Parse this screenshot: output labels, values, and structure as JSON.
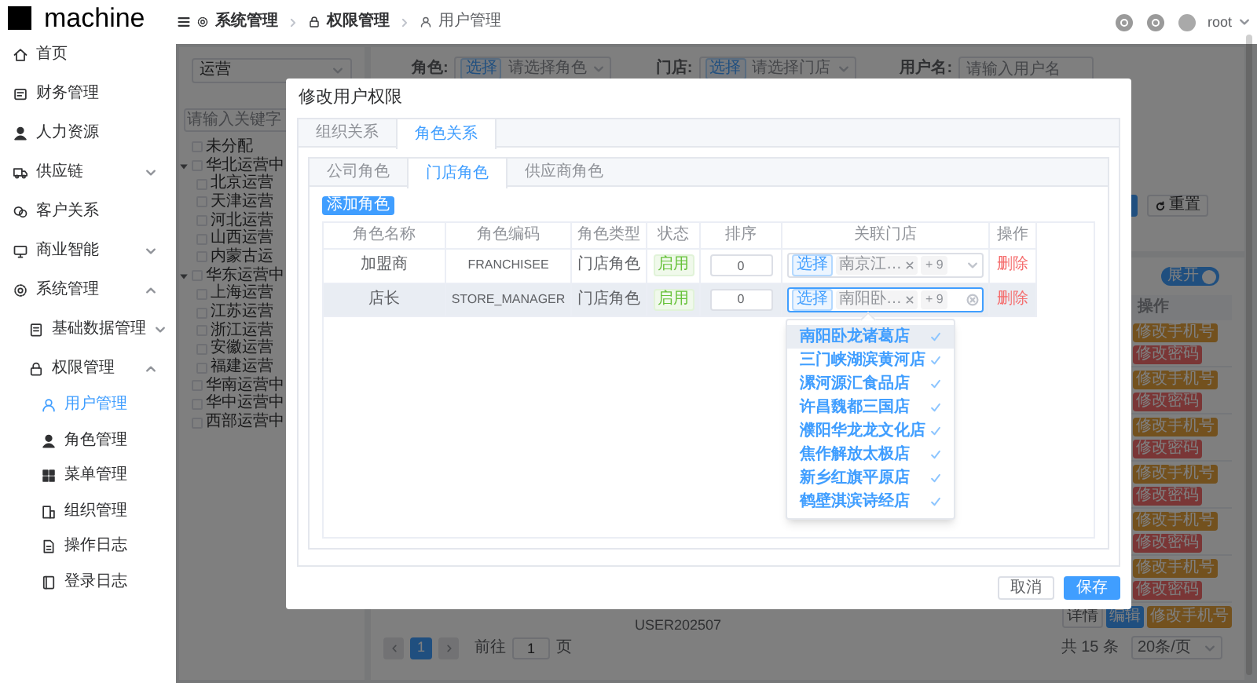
{
  "header": {
    "logo": "machine",
    "breadcrumb": [
      "系统管理",
      "权限管理",
      "用户管理"
    ],
    "user": "root"
  },
  "sidebar": {
    "items": [
      {
        "label": "首页",
        "selected": false
      },
      {
        "label": "财务管理",
        "selected": false
      },
      {
        "label": "人力资源",
        "selected": false
      },
      {
        "label": "供应链",
        "selected": false,
        "expanded": false
      },
      {
        "label": "客户关系",
        "selected": false
      },
      {
        "label": "商业智能",
        "selected": false,
        "expanded": false
      },
      {
        "label": "系统管理",
        "selected": false,
        "expanded": true,
        "children": [
          {
            "label": "基础数据管理",
            "selected": false,
            "expanded": false
          },
          {
            "label": "权限管理",
            "selected": false,
            "expanded": true,
            "children": [
              {
                "label": "用户管理",
                "selected": true
              },
              {
                "label": "角色管理",
                "selected": false
              },
              {
                "label": "菜单管理",
                "selected": false
              },
              {
                "label": "组织管理",
                "selected": false
              },
              {
                "label": "操作日志",
                "selected": false
              },
              {
                "label": "登录日志",
                "selected": false
              }
            ]
          }
        ]
      }
    ]
  },
  "org_panel": {
    "select": "运营",
    "search_placeholder": "请输入关键字",
    "tree": [
      {
        "label": "未分配",
        "checked": false
      },
      {
        "label": "华北运营中",
        "checked": false,
        "expanded": true,
        "children": [
          {
            "label": "北京运营",
            "checked": false
          },
          {
            "label": "天津运营",
            "checked": false
          },
          {
            "label": "河北运营",
            "checked": false
          },
          {
            "label": "山西运营",
            "checked": false
          },
          {
            "label": "内蒙古运",
            "checked": false
          }
        ]
      },
      {
        "label": "华东运营中",
        "checked": false,
        "expanded": true,
        "children": [
          {
            "label": "上海运营",
            "checked": false
          },
          {
            "label": "江苏运营",
            "checked": false
          },
          {
            "label": "浙江运营",
            "checked": false
          },
          {
            "label": "安徽运营",
            "checked": false
          },
          {
            "label": "福建运营",
            "checked": false
          }
        ]
      },
      {
        "label": "华南运营中",
        "checked": false
      },
      {
        "label": "华中运营中",
        "checked": false
      },
      {
        "label": "西部运营中",
        "checked": false
      }
    ]
  },
  "filters": [
    {
      "kind": "select",
      "label": "角色:",
      "tag": "选择",
      "placeholder": "请选择角色"
    },
    {
      "kind": "select",
      "label": "门店:",
      "tag": "选择",
      "placeholder": "请选择门店"
    },
    {
      "kind": "input",
      "label": "用户名:",
      "placeholder": "请输入用户名"
    }
  ],
  "reset_button": "重置",
  "toggle": {
    "label": "展开",
    "on": true
  },
  "user_table": {
    "action_header": "操作",
    "rows": [
      {
        "actions": [
          {
            "kind": "phone",
            "label": "修改手机号"
          },
          {
            "kind": "password",
            "label": "修改密码"
          }
        ]
      },
      {
        "actions": [
          {
            "kind": "phone",
            "label": "修改手机号"
          },
          {
            "kind": "password",
            "label": "修改密码"
          }
        ]
      },
      {
        "actions": [
          {
            "kind": "phone",
            "label": "修改手机号"
          },
          {
            "kind": "password",
            "label": "修改密码"
          }
        ]
      },
      {
        "actions": [
          {
            "kind": "phone",
            "label": "修改手机号"
          },
          {
            "kind": "password",
            "label": "修改密码"
          }
        ]
      },
      {
        "actions": [
          {
            "kind": "phone",
            "label": "修改手机号"
          },
          {
            "kind": "password",
            "label": "修改密码"
          }
        ]
      },
      {
        "actions": [
          {
            "kind": "phone",
            "label": "修改手机号"
          },
          {
            "kind": "password",
            "label": "修改密码"
          }
        ]
      },
      {
        "user": "USER202507",
        "actions": [
          {
            "kind": "detail",
            "label": "详情"
          },
          {
            "kind": "edit",
            "label": "编辑"
          },
          {
            "kind": "phone",
            "label": "修改手机号"
          }
        ]
      }
    ]
  },
  "pagination": {
    "pages": [
      {
        "label": "1",
        "selected": true
      }
    ],
    "goto_label": "前往",
    "goto_value": "1",
    "page_unit": "页",
    "total": "共 15 条",
    "page_size": "20条/页"
  },
  "dialog": {
    "title": "修改用户权限",
    "tabs": [
      {
        "label": "组织关系",
        "selected": false
      },
      {
        "label": "角色关系",
        "selected": true
      }
    ],
    "subtabs": [
      {
        "label": "公司角色",
        "selected": false
      },
      {
        "label": "门店角色",
        "selected": true
      },
      {
        "label": "供应商角色",
        "selected": false
      }
    ],
    "add_button": "添加角色",
    "table": {
      "columns": [
        "角色名称",
        "角色编码",
        "角色类型",
        "状态",
        "排序",
        "关联门店",
        "操作"
      ],
      "rows": [
        {
          "name": "加盟商",
          "code": "FRANCHISEE",
          "type": "门店角色",
          "status": {
            "label": "启用",
            "kind": "success"
          },
          "sort": "0",
          "stores": {
            "button": "选择",
            "tags": [
              "南京江…"
            ],
            "more": "+ 9",
            "focused": false
          },
          "action": "删除",
          "hovered": false
        },
        {
          "name": "店长",
          "code": "STORE_MANAGER",
          "type": "门店角色",
          "status": {
            "label": "启用",
            "kind": "success"
          },
          "sort": "0",
          "stores": {
            "button": "选择",
            "tags": [
              "南阳卧…"
            ],
            "more": "+ 9",
            "focused": true
          },
          "action": "删除",
          "hovered": true
        }
      ]
    },
    "dropdown": {
      "items": [
        {
          "label": "南阳卧龙诸葛店",
          "checked": true,
          "hovered": true
        },
        {
          "label": "三门峡湖滨黄河店",
          "checked": true,
          "hovered": false
        },
        {
          "label": "漯河源汇食品店",
          "checked": true,
          "hovered": false
        },
        {
          "label": "许昌魏都三国店",
          "checked": true,
          "hovered": false
        },
        {
          "label": "濮阳华龙龙文化店",
          "checked": true,
          "hovered": false
        },
        {
          "label": "焦作解放太极店",
          "checked": true,
          "hovered": false
        },
        {
          "label": "新乡红旗平原店",
          "checked": true,
          "hovered": false
        },
        {
          "label": "鹤壁淇滨诗经店",
          "checked": true,
          "hovered": false
        }
      ]
    },
    "buttons": [
      {
        "kind": "secondary",
        "label": "取消"
      },
      {
        "kind": "primary",
        "label": "保存"
      }
    ]
  }
}
